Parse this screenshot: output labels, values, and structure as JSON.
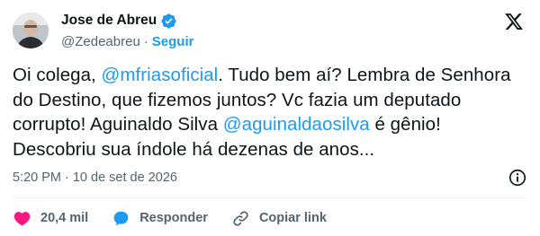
{
  "author": {
    "name": "Jose de Abreu",
    "handle": "@Zedeabreu",
    "separator": "·",
    "follow_label": "Seguir"
  },
  "tweet": {
    "part1": "Oi colega, ",
    "mention1": "@mfriasoficial",
    "part2": ". Tudo bem aí? Lembra de Senhora do Destino, que fizemos juntos? Vc fazia um deputado corrupto! Aguinaldo Silva ",
    "mention2": "@aguinaldaosilva",
    "part3": " é gênio! Descobriu sua índole há dezenas de anos..."
  },
  "meta": {
    "time": "5:20 PM",
    "separator": "·",
    "date": "10 de set de 2026"
  },
  "actions": {
    "likes": "20,4 mil",
    "reply_label": "Responder",
    "copy_label": "Copiar link"
  },
  "colors": {
    "accent": "#1d9bf0",
    "heart": "#f91880",
    "text": "#0f1419",
    "muted": "#536471"
  },
  "icons": {
    "verified": "verified-badge-icon",
    "logo": "x-logo-icon",
    "info": "info-icon",
    "like": "heart-icon",
    "reply": "reply-bubble-icon",
    "copy": "link-icon"
  }
}
